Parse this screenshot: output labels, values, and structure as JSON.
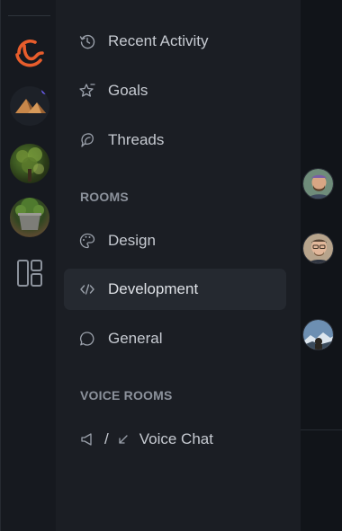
{
  "sidebar": {
    "nav": [
      {
        "label": "Recent Activity",
        "icon": "history-icon"
      },
      {
        "label": "Goals",
        "icon": "star-flag-icon"
      },
      {
        "label": "Threads",
        "icon": "threads-icon"
      }
    ],
    "rooms_title": "ROOMS",
    "rooms": [
      {
        "label": "Design",
        "icon": "palette-icon"
      },
      {
        "label": "Development",
        "icon": "code-icon",
        "active": true
      },
      {
        "label": "General",
        "icon": "chat-bubble-icon"
      }
    ],
    "voice_title": "VOICE ROOMS",
    "voice": {
      "separator": "/",
      "label": "Voice Chat"
    }
  },
  "colors": {
    "accent_notification": "#6a5df0",
    "logo_orange": "#e85d2c",
    "active_row": "#252930"
  }
}
